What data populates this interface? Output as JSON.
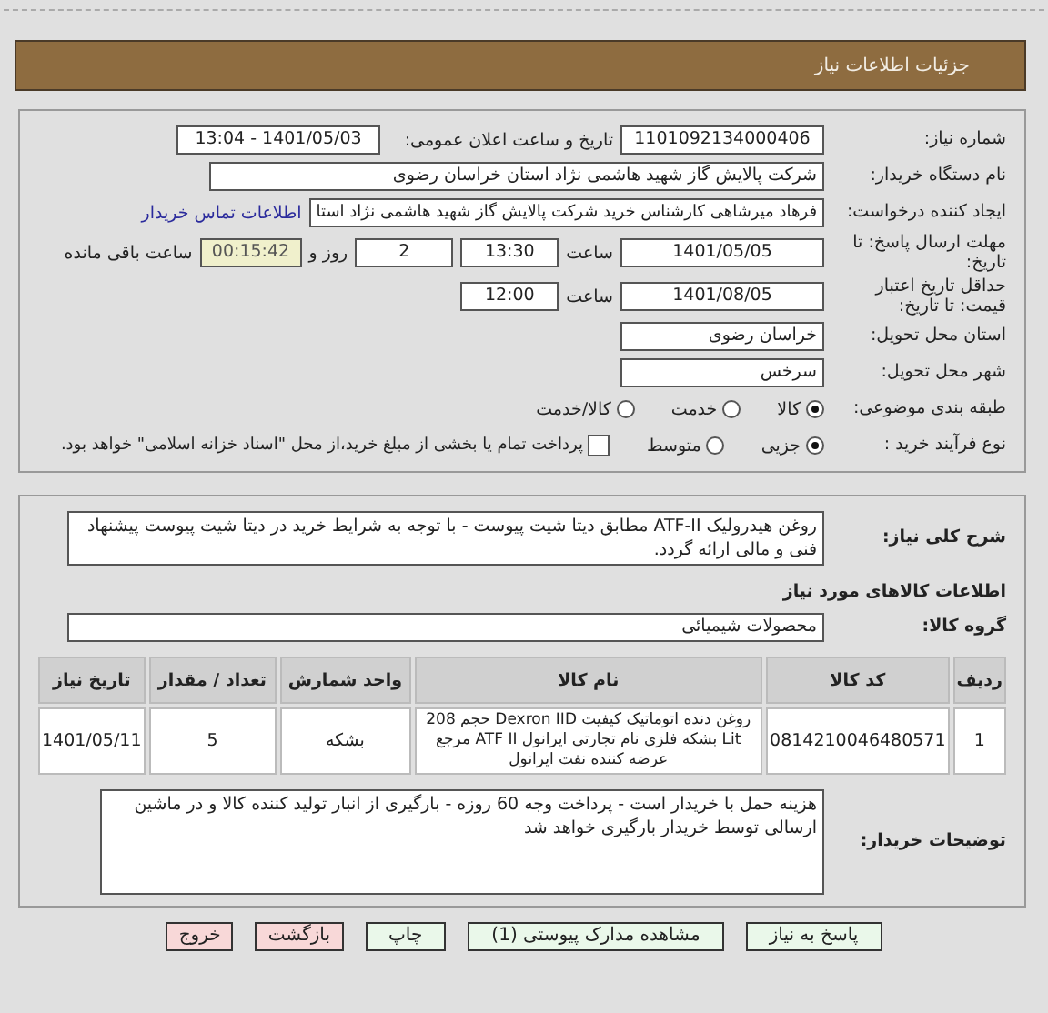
{
  "header": {
    "title": "جزئیات اطلاعات نیاز"
  },
  "details": {
    "need_number": {
      "label": "شماره نیاز:",
      "value": "1101092134000406"
    },
    "announce": {
      "label": "تاریخ و ساعت اعلان عمومی:",
      "value": "1401/05/03 - 13:04"
    },
    "buyer": {
      "label": "نام دستگاه خریدار:",
      "value": "شرکت پالایش گاز شهید هاشمی نژاد   استان خراسان رضوی"
    },
    "requester": {
      "label": "ایجاد کننده درخواست:",
      "value": "فرهاد میرشاهی کارشناس خرید شرکت پالایش گاز شهید هاشمی نژاد   استا",
      "link": "اطلاعات تماس خریدار"
    },
    "deadline": {
      "label": "مهلت ارسال پاسخ: تا تاریخ:",
      "date": "1401/05/05",
      "time_label": "ساعت",
      "time": "13:30",
      "days": "2",
      "days_label": "روز و",
      "remaining": "00:15:42",
      "remaining_label": "ساعت باقی مانده"
    },
    "validity": {
      "label": "حداقل تاریخ اعتبار قیمت: تا تاریخ:",
      "date": "1401/08/05",
      "time_label": "ساعت",
      "time": "12:00"
    },
    "province": {
      "label": "استان محل تحویل:",
      "value": "خراسان رضوی"
    },
    "city": {
      "label": "شهر محل تحویل:",
      "value": "سرخس"
    },
    "category": {
      "label": "طبقه بندی موضوعی:",
      "options": [
        {
          "label": "کالا",
          "selected": true
        },
        {
          "label": "خدمت",
          "selected": false
        },
        {
          "label": "کالا/خدمت",
          "selected": false
        }
      ]
    },
    "process": {
      "label": "نوع فرآیند خرید :",
      "options": [
        {
          "label": "جزیی",
          "selected": true
        },
        {
          "label": "متوسط",
          "selected": false
        }
      ],
      "treasury": {
        "label": "پرداخت تمام یا بخشی از مبلغ خرید،از محل \"اسناد خزانه اسلامی\" خواهد بود.",
        "checked": false
      }
    }
  },
  "needs": {
    "summary": {
      "label": "شرح کلی نیاز:",
      "value": "روغن هیدرولیک ATF-II مطابق دیتا شیت پیوست - با توجه به شرایط خرید در دیتا شیت پیوست پیشنهاد فنی و مالی ارائه گردد."
    },
    "goods_title": "اطلاعات کالاهای مورد نیاز",
    "group": {
      "label": "گروه کالا:",
      "value": "محصولات شیمیائی"
    },
    "table": {
      "columns": [
        "ردیف",
        "کد کالا",
        "نام کالا",
        "واحد شمارش",
        "تعداد / مقدار",
        "تاریخ نیاز"
      ],
      "rows": [
        [
          "1",
          "0814210046480571",
          "روغن دنده اتوماتیک کیفیت Dexron IID حجم 208 Lit بشکه فلزی نام تجارتی ایرانول ATF II مرجع عرضه کننده نفت ایرانول",
          "بشکه",
          "5",
          "1401/05/11"
        ]
      ]
    },
    "notes": {
      "label": "توضیحات خریدار:",
      "value": "هزینه حمل با خریدار است - پرداخت وجه 60 روزه - بارگیری از انبار تولید کننده کالا و در ماشین ارسالی توسط خریدار بارگیری خواهد شد"
    }
  },
  "buttons": [
    {
      "label": "پاسخ به نیاز",
      "kind": "action"
    },
    {
      "label": "مشاهده مدارک پیوستی (1)",
      "kind": "action"
    },
    {
      "label": "چاپ",
      "kind": "action"
    },
    {
      "label": "بازگشت",
      "kind": "exit"
    },
    {
      "label": "خروج",
      "kind": "exit"
    }
  ]
}
